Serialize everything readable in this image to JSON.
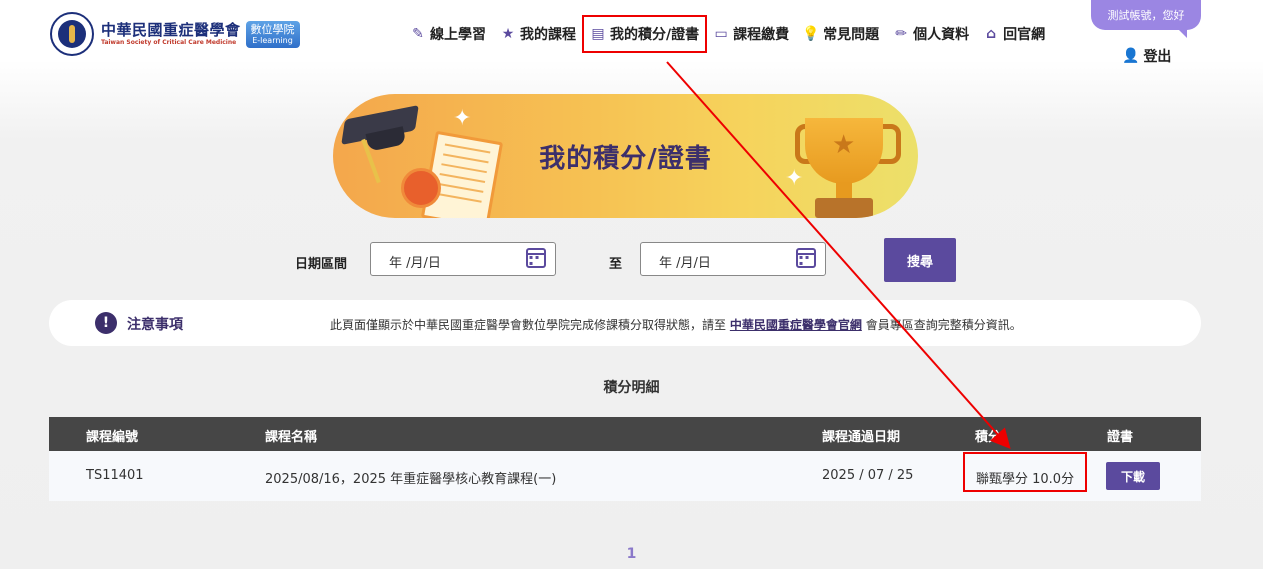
{
  "header": {
    "logo_zh": "中華民國重症醫學會",
    "logo_en": "Taiwan Society of Critical Care Medicine",
    "badge_line1": "數位學院",
    "badge_line2": "E-learning",
    "nav": [
      {
        "label": "線上學習",
        "icon": "edit-icon"
      },
      {
        "label": "我的課程",
        "icon": "star-icon"
      },
      {
        "label": "我的積分/證書",
        "icon": "certificate-icon"
      },
      {
        "label": "課程繳費",
        "icon": "card-icon"
      },
      {
        "label": "常見問題",
        "icon": "lightbulb-icon"
      },
      {
        "label": "個人資料",
        "icon": "pencil-icon"
      },
      {
        "label": "回官網",
        "icon": "home-icon"
      }
    ],
    "greeting": "測試帳號，您好",
    "logout": "登出"
  },
  "banner": {
    "title": "我的積分/證書"
  },
  "filter": {
    "range_label": "日期區間",
    "start_placeholder": "年 /月/日",
    "to_label": "至",
    "end_placeholder": "年 /月/日",
    "search_button": "搜尋"
  },
  "notice": {
    "title": "注意事項",
    "text_before": "此頁面僅顯示於中華民國重症醫學會數位學院完成修課積分取得狀態，請至",
    "link": "中華民國重症醫學會官網",
    "text_after": "會員專區查詢完整積分資訊。"
  },
  "section_title": "積分明細",
  "table": {
    "headers": [
      "課程編號",
      "課程名稱",
      "課程通過日期",
      "積分",
      "證書"
    ],
    "rows": [
      {
        "code": "TS11401",
        "name": "2025/08/16，2025 年重症醫學核心教育課程(一)",
        "date": "2025 / 07 / 25",
        "credits": "聯甄學分 10.0分",
        "cert_button": "下載"
      }
    ]
  },
  "pagination": {
    "current": "1"
  },
  "colors": {
    "primary": "#5b4a9e",
    "header_bg": "#464646",
    "highlight": "#ee0000"
  }
}
